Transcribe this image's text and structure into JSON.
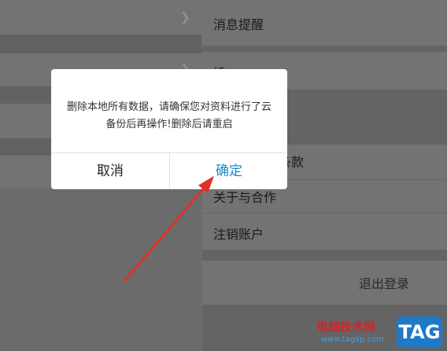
{
  "settings": {
    "notification_label": "消息提醒",
    "partial_label_2": "插",
    "terms_partial_label": "条款",
    "about_label": "关于与合作",
    "cancel_account_label": "注销账户",
    "logout_label": "退出登录"
  },
  "dialog": {
    "message": "删除本地所有数据，请确保您对资料进行了云备份后再操作!删除后请重启",
    "cancel_label": "取消",
    "confirm_label": "确定"
  },
  "watermark": {
    "site_name": "电脑技术网",
    "url": "www.tagxp.com",
    "tag": "TAG"
  },
  "colors": {
    "confirm": "#1e88c7",
    "arrow": "#e0322a"
  }
}
